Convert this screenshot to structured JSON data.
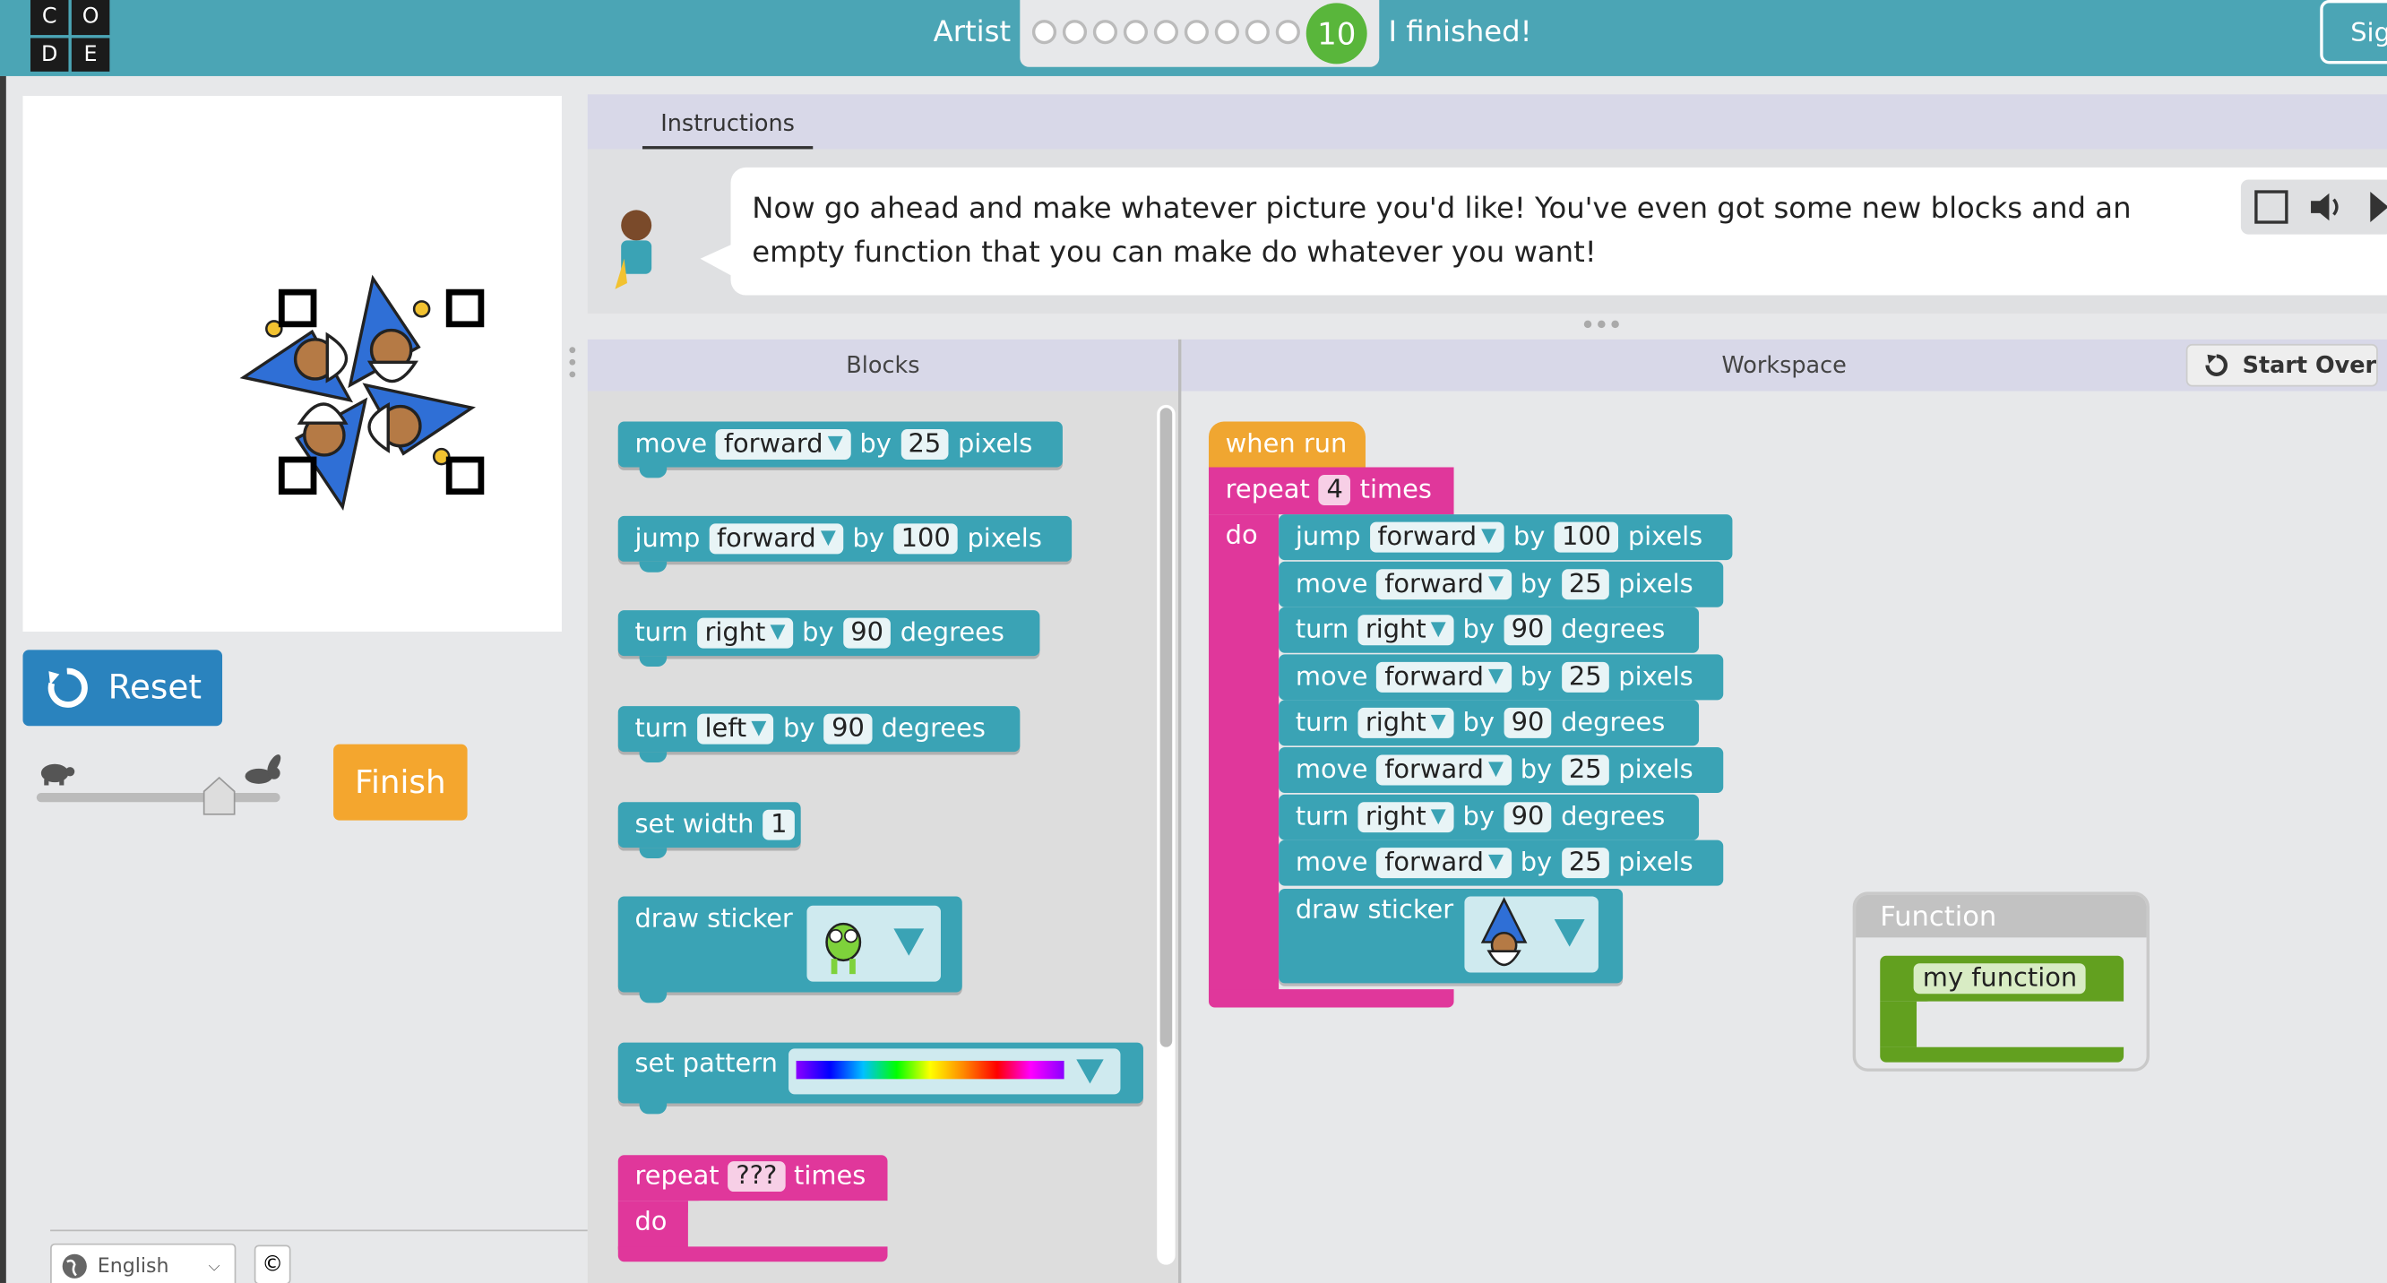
{
  "header": {
    "logo_letters": [
      "C",
      "O",
      "D",
      "E"
    ],
    "lesson": "Artist",
    "level_number": "10",
    "status": "I finished!",
    "signin": "Sig",
    "progress_dots": 9
  },
  "left": {
    "reset_label": "Reset",
    "finish_label": "Finish",
    "language": "English",
    "copyright": "©"
  },
  "instructions": {
    "tab": "Instructions",
    "text": "Now go ahead and make whatever picture you'd like! You've even got some new blocks and an empty function that you can make do whatever you want!"
  },
  "panels": {
    "blocks_title": "Blocks",
    "workspace_title": "Workspace",
    "start_over": "Start Over"
  },
  "toolbox": [
    {
      "kw": "move",
      "dir": "forward",
      "by": "by",
      "val": "25",
      "unit": "pixels"
    },
    {
      "kw": "jump",
      "dir": "forward",
      "by": "by",
      "val": "100",
      "unit": "pixels"
    },
    {
      "kw": "turn",
      "dir": "right",
      "by": "by",
      "val": "90",
      "unit": "degrees"
    },
    {
      "kw": "turn",
      "dir": "left",
      "by": "by",
      "val": "90",
      "unit": "degrees"
    }
  ],
  "setwidth": {
    "label": "set width",
    "val": "1"
  },
  "draw_sticker": "draw sticker",
  "set_pattern": "set pattern",
  "repeat_tb": {
    "kw": "repeat",
    "val": "???",
    "times": "times",
    "do": "do"
  },
  "workspace": {
    "when_run": "when run",
    "repeat": {
      "kw": "repeat",
      "val": "4",
      "times": "times",
      "do": "do"
    },
    "body": [
      {
        "kw": "jump",
        "dir": "forward",
        "by": "by",
        "val": "100",
        "unit": "pixels"
      },
      {
        "kw": "move",
        "dir": "forward",
        "by": "by",
        "val": "25",
        "unit": "pixels"
      },
      {
        "kw": "turn",
        "dir": "right",
        "by": "by",
        "val": "90",
        "unit": "degrees"
      },
      {
        "kw": "move",
        "dir": "forward",
        "by": "by",
        "val": "25",
        "unit": "pixels"
      },
      {
        "kw": "turn",
        "dir": "right",
        "by": "by",
        "val": "90",
        "unit": "degrees"
      },
      {
        "kw": "move",
        "dir": "forward",
        "by": "by",
        "val": "25",
        "unit": "pixels"
      },
      {
        "kw": "turn",
        "dir": "right",
        "by": "by",
        "val": "90",
        "unit": "degrees"
      },
      {
        "kw": "move",
        "dir": "forward",
        "by": "by",
        "val": "25",
        "unit": "pixels"
      }
    ],
    "draw_sticker": "draw sticker"
  },
  "function_box": {
    "title": "Function",
    "name": "my function"
  }
}
